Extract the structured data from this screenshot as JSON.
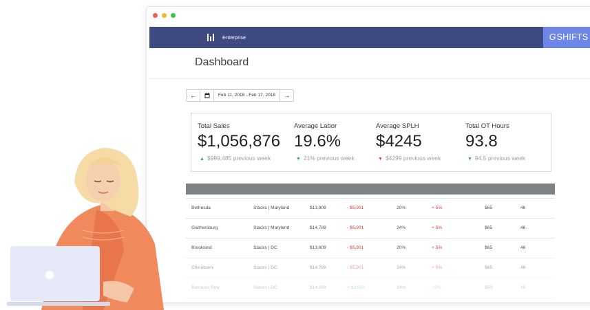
{
  "window": {
    "controls": [
      "close",
      "minimize",
      "maximize"
    ]
  },
  "nav": {
    "label": "Enterprise",
    "icon": "bar-chart-icon",
    "brand": "SHIFTS",
    "brand_mark": "G",
    "color": "#3e4b82",
    "brand_color": "#6d86e8"
  },
  "page": {
    "title": "Dashboard"
  },
  "date_picker": {
    "prev": "←",
    "calendar": "calendar-icon",
    "range": "Feb 11, 2018 - Feb 17, 2018",
    "next": "→"
  },
  "stats": [
    {
      "label": "Total Sales",
      "value": "$1,056,876",
      "trend": "up",
      "previous": "$989,485 previous week"
    },
    {
      "label": "Average Labor",
      "value": "19.6%",
      "trend": "down",
      "previous": "21% previous week"
    },
    {
      "label": "Average SPLH",
      "value": "$4245",
      "trend": "down",
      "previous": "$4299 previous week"
    },
    {
      "label": "Total OT Hours",
      "value": "93.8",
      "trend": "down",
      "previous": "94.5 previous week"
    }
  ],
  "table": {
    "rows": [
      {
        "location": "Bethesda",
        "group": "Stacks | Maryland",
        "sales": "$13,809",
        "diff": "- $5,901",
        "labor": "20%",
        "labor_diff": "+ 5%",
        "splh": "$65",
        "ot": "46"
      },
      {
        "location": "Gaithersburg",
        "group": "Stacks | Maryland",
        "sales": "$14,789",
        "diff": "- $5,901",
        "labor": "24%",
        "labor_diff": "+ 5%",
        "splh": "$65",
        "ot": "46"
      },
      {
        "location": "Brookland",
        "group": "Stacks | DC",
        "sales": "$13,809",
        "diff": "- $5,901",
        "labor": "20%",
        "labor_diff": "+ 5%",
        "splh": "$65",
        "ot": "46"
      },
      {
        "location": "Chinatown",
        "group": "Stacks | DC",
        "sales": "$14,789",
        "diff": "- $5,901",
        "labor": "24%",
        "labor_diff": "+ 5%",
        "splh": "$65",
        "ot": "46"
      },
      {
        "location": "Barracks Row",
        "group": "Stacks | DC",
        "sales": "$14,289",
        "diff": "+ $3,500",
        "labor": "24%",
        "labor_diff": "- 5%",
        "splh": "$50",
        "ot": "10"
      }
    ]
  }
}
